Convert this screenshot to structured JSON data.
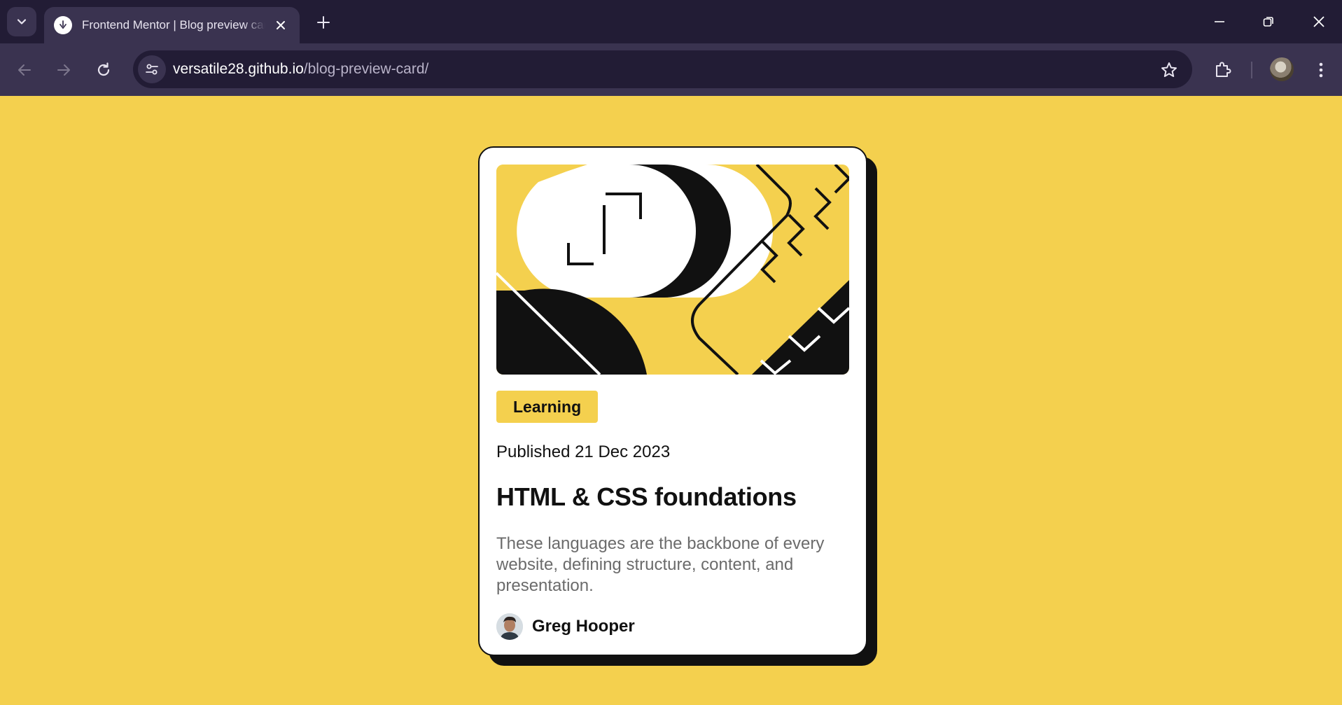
{
  "browser": {
    "tab_title": "Frontend Mentor | Blog preview card",
    "url_host": "versatile28.github.io",
    "url_path": "/blog-preview-card/"
  },
  "card": {
    "tag": "Learning",
    "published": "Published 21 Dec 2023",
    "title": "HTML & CSS foundations",
    "description": "These languages are the backbone of every website, defining structure, content, and presentation.",
    "author_name": "Greg Hooper"
  },
  "colors": {
    "background": "#f4d04e",
    "card": "#ffffff",
    "ink": "#111111",
    "muted_text": "#6b6b6b",
    "browser_frame": "#221c35",
    "browser_toolbar": "#3a3350"
  }
}
